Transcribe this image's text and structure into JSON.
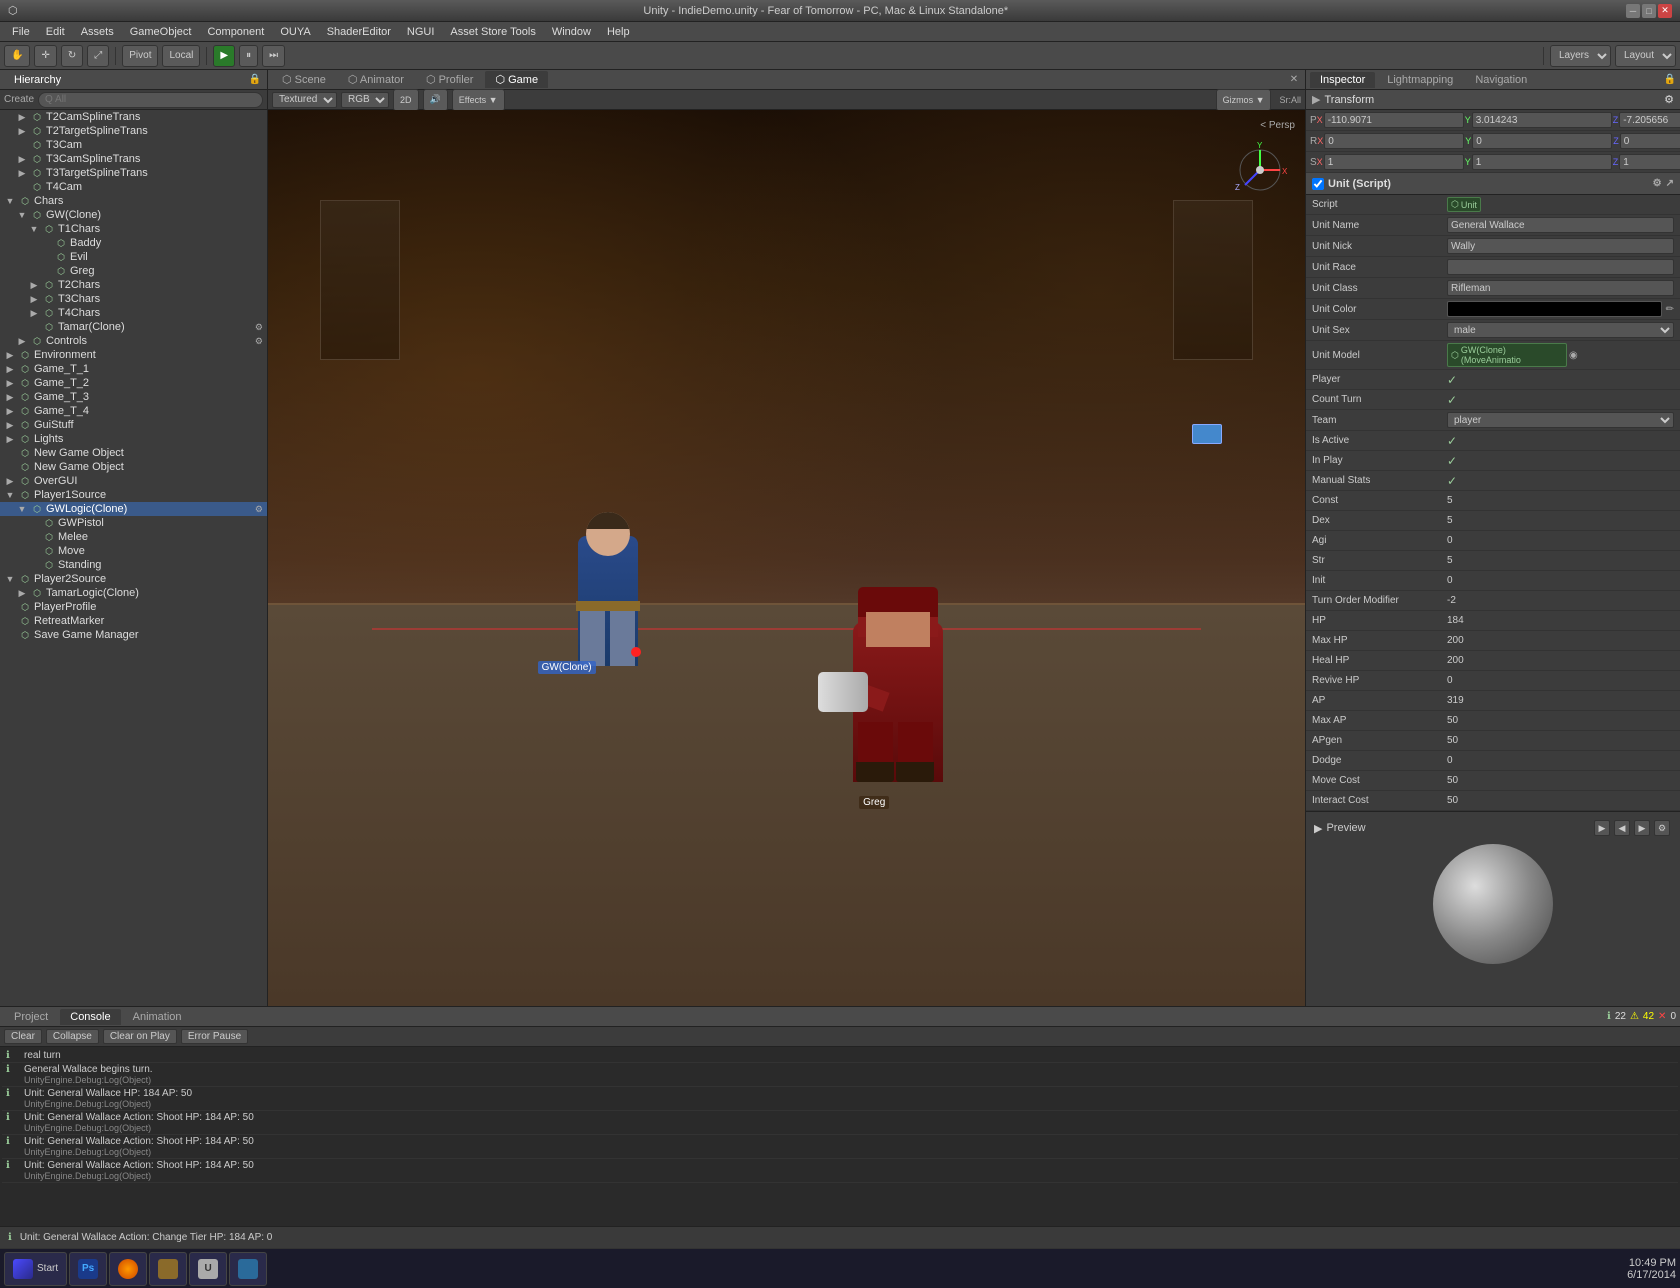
{
  "titleBar": {
    "title": "Unity - IndieDemo.unity - Fear of Tomorrow - PC, Mac & Linux Standalone*",
    "minimize": "─",
    "maximize": "□",
    "close": "✕"
  },
  "menuBar": {
    "items": [
      "File",
      "Edit",
      "Assets",
      "GameObject",
      "Component",
      "OUYA",
      "ShaderEditor",
      "NGUI",
      "Asset Store Tools",
      "Window",
      "Help"
    ]
  },
  "toolbar": {
    "pivot_label": "Pivot",
    "local_label": "Local",
    "play_label": "▶",
    "pause_label": "⏸",
    "step_label": "⏭",
    "layers_label": "Layers",
    "layout_label": "Layout"
  },
  "hierarchy": {
    "title": "Hierarchy",
    "searchPlaceholder": "Q All",
    "items": [
      {
        "indent": 1,
        "label": "T2CamSplineTrans",
        "arrow": "▶",
        "depth": 1
      },
      {
        "indent": 1,
        "label": "T2TargetSplineTrans",
        "arrow": "▶",
        "depth": 1
      },
      {
        "indent": 1,
        "label": "T3Cam",
        "arrow": "",
        "depth": 1
      },
      {
        "indent": 1,
        "label": "T3CamSplineTrans",
        "arrow": "▶",
        "depth": 1
      },
      {
        "indent": 1,
        "label": "T3TargetSplineTrans",
        "arrow": "▶",
        "depth": 1
      },
      {
        "indent": 1,
        "label": "T4Cam",
        "arrow": "",
        "depth": 1
      },
      {
        "indent": 0,
        "label": "Chars",
        "arrow": "▼",
        "depth": 0
      },
      {
        "indent": 1,
        "label": "GW(Clone)",
        "arrow": "▼",
        "depth": 1
      },
      {
        "indent": 2,
        "label": "T1Chars",
        "arrow": "▼",
        "depth": 2
      },
      {
        "indent": 3,
        "label": "Baddy",
        "arrow": "",
        "depth": 3
      },
      {
        "indent": 3,
        "label": "Evil",
        "arrow": "",
        "depth": 3
      },
      {
        "indent": 3,
        "label": "Greg",
        "arrow": "",
        "depth": 3
      },
      {
        "indent": 2,
        "label": "T2Chars",
        "arrow": "▶",
        "depth": 2
      },
      {
        "indent": 2,
        "label": "T3Chars",
        "arrow": "▶",
        "depth": 2
      },
      {
        "indent": 2,
        "label": "T4Chars",
        "arrow": "▶",
        "depth": 2
      },
      {
        "indent": 2,
        "label": "Tamar(Clone)",
        "arrow": "",
        "depth": 2
      },
      {
        "indent": 1,
        "label": "Controls",
        "arrow": "▶",
        "depth": 1
      },
      {
        "indent": 0,
        "label": "Environment",
        "arrow": "▶",
        "depth": 0
      },
      {
        "indent": 0,
        "label": "Game_T_1",
        "arrow": "▶",
        "depth": 0
      },
      {
        "indent": 0,
        "label": "Game_T_2",
        "arrow": "▶",
        "depth": 0
      },
      {
        "indent": 0,
        "label": "Game_T_3",
        "arrow": "▶",
        "depth": 0
      },
      {
        "indent": 0,
        "label": "Game_T_4",
        "arrow": "▶",
        "depth": 0
      },
      {
        "indent": 0,
        "label": "GuiStuff",
        "arrow": "▶",
        "depth": 0
      },
      {
        "indent": 0,
        "label": "Lights",
        "arrow": "▶",
        "depth": 0
      },
      {
        "indent": 0,
        "label": "New Game Object",
        "arrow": "",
        "depth": 0
      },
      {
        "indent": 0,
        "label": "New Game Object",
        "arrow": "",
        "depth": 0
      },
      {
        "indent": 0,
        "label": "OverGUI",
        "arrow": "▶",
        "depth": 0
      },
      {
        "indent": 0,
        "label": "Player1Source",
        "arrow": "▼",
        "depth": 0
      },
      {
        "indent": 1,
        "label": "GWLogic(Clone)",
        "arrow": "▼",
        "depth": 1,
        "selected": true
      },
      {
        "indent": 2,
        "label": "GWPistol",
        "arrow": "",
        "depth": 2
      },
      {
        "indent": 2,
        "label": "Melee",
        "arrow": "",
        "depth": 2
      },
      {
        "indent": 2,
        "label": "Move",
        "arrow": "",
        "depth": 2
      },
      {
        "indent": 2,
        "label": "Standing",
        "arrow": "",
        "depth": 2
      },
      {
        "indent": 0,
        "label": "Player2Source",
        "arrow": "▼",
        "depth": 0
      },
      {
        "indent": 1,
        "label": "TamarLogic(Clone)",
        "arrow": "▶",
        "depth": 1
      },
      {
        "indent": 0,
        "label": "PlayerProfile",
        "arrow": "",
        "depth": 0
      },
      {
        "indent": 0,
        "label": "RetreatMarker",
        "arrow": "",
        "depth": 0
      },
      {
        "indent": 0,
        "label": "Save Game Manager",
        "arrow": "",
        "depth": 0
      }
    ]
  },
  "viewTabs": [
    "Scene",
    "Animator",
    "Profiler",
    "Game"
  ],
  "activeViewTab": "Game",
  "viewToolbar": {
    "textured": "Textured",
    "rgb": "RGB",
    "twoD": "2D",
    "effects": "Effects ▼",
    "gizmos": "Gizmos ▼",
    "srAll": "Sr:All"
  },
  "gameLabels": {
    "gw_clone": "GW(Clone)",
    "greg": "Greg",
    "persp": "< Persp"
  },
  "inspector": {
    "title": "Inspector",
    "tabs": [
      "Inspector",
      "Lightmapping",
      "Navigation"
    ],
    "transform": {
      "px": "-110.9071",
      "py": "3.014243",
      "pz": "-7.205656",
      "rx": "0",
      "ry": "0",
      "rz": "0",
      "sx": "1",
      "sy": "1",
      "sz": "1"
    },
    "component": {
      "name": "Unit (Script)",
      "scriptLabel": "Script",
      "scriptValue": "Unit",
      "unitNameLabel": "Unit Name",
      "unitNameValue": "General Wallace",
      "unitNickLabel": "Unit Nick",
      "unitNickValue": "Wally",
      "unitRaceLabel": "Unit Race",
      "unitRaceValue": "",
      "unitClassLabel": "Unit Class",
      "unitClassValue": "Rifleman",
      "unitColorLabel": "Unit Color",
      "unitSexLabel": "Unit Sex",
      "unitSexValue": "male",
      "unitModelLabel": "Unit Model",
      "unitModelValue": "GW(Clone) (MoveAnimatio",
      "playerLabel": "Player",
      "playerValue": "✓",
      "countTurnLabel": "Count Turn",
      "countTurnValue": "✓",
      "teamLabel": "Team",
      "teamValue": "player",
      "isActiveLabel": "Is Active",
      "isActiveValue": "✓",
      "inPlayLabel": "In Play",
      "inPlayValue": "✓",
      "manualStatsLabel": "Manual Stats",
      "manualStatsValue": "✓",
      "constLabel": "Const",
      "constValue": "5",
      "dexLabel": "Dex",
      "dexValue": "5",
      "agiLabel": "Agi",
      "agiValue": "0",
      "strLabel": "Str",
      "strValue": "5",
      "initLabel": "Init",
      "initValue": "0",
      "turnOrderModLabel": "Turn Order Modifier",
      "turnOrderModValue": "-2",
      "hpLabel": "HP",
      "hpValue": "184",
      "maxHpLabel": "Max HP",
      "maxHpValue": "200",
      "healHpLabel": "Heal HP",
      "healHpValue": "200",
      "reviveHpLabel": "Revive HP",
      "reviveHpValue": "0",
      "apLabel": "AP",
      "apValue": "319",
      "maxApLabel": "Max AP",
      "maxApValue": "50",
      "apGenLabel": "APgen",
      "apGenValue": "50",
      "dodgeLabel": "Dodge",
      "dodgeValue": "0",
      "moveCostLabel": "Move Cost",
      "moveCostValue": "50",
      "interactCostLabel": "Interact Cost",
      "interactCostValue": "50"
    },
    "preview": {
      "title": "Preview"
    }
  },
  "console": {
    "tabs": [
      "Project",
      "Console",
      "Animation"
    ],
    "activeTab": "Console",
    "buttons": [
      "Clear",
      "Collapse",
      "Clear on Play",
      "Error Pause"
    ],
    "counts": {
      "info": "22",
      "warn": "42",
      "error": "0"
    },
    "lines": [
      {
        "type": "info",
        "msg": "real turn",
        "sub": ""
      },
      {
        "type": "info",
        "msg": "General Wallace begins turn.",
        "sub": "UnityEngine.Debug:Log(Object)"
      },
      {
        "type": "info",
        "msg": "Unit: General Wallace  HP: 184  AP: 50",
        "sub": "UnityEngine.Debug:Log(Object)"
      },
      {
        "type": "info",
        "msg": "Unit: General Wallace  Action: Shoot  HP: 184  AP: 50",
        "sub": "UnityEngine.Debug:Log(Object)"
      },
      {
        "type": "info",
        "msg": "Unit: General Wallace  Action: Shoot  HP: 184  AP: 50",
        "sub": "UnityEngine.Debug:Log(Object)"
      },
      {
        "type": "info",
        "msg": "Unit: General Wallace  Action: Shoot  HP: 184  AP: 50",
        "sub": "UnityEngine.Debug:Log(Object)"
      }
    ]
  },
  "statusBar": {
    "text": "Unit: General Wallace  Action: Change Tier  HP: 184  AP: 0"
  },
  "taskbar": {
    "time": "10:49 PM",
    "date": "6/17/2014",
    "items": [
      "Start",
      "ps",
      "Firefox",
      "Files",
      "Unity",
      "Network"
    ]
  }
}
